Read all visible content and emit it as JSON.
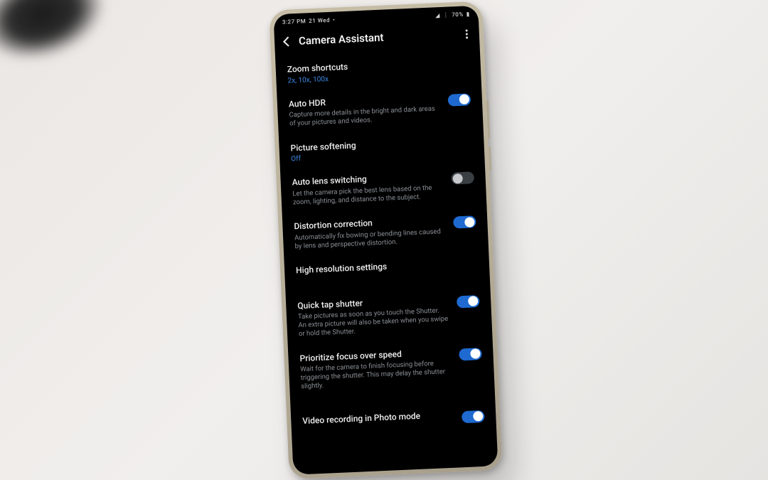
{
  "status": {
    "time": "3:27 PM",
    "date": "21 Wed",
    "battery": "70%"
  },
  "header": {
    "title": "Camera Assistant"
  },
  "settings": {
    "zoom_shortcuts": {
      "title": "Zoom shortcuts",
      "value": "2x, 10x, 100x"
    },
    "auto_hdr": {
      "title": "Auto HDR",
      "sub": "Capture more details in the bright and dark areas of your pictures and videos.",
      "on": true
    },
    "picture_softening": {
      "title": "Picture softening",
      "value": "Off"
    },
    "auto_lens": {
      "title": "Auto lens switching",
      "sub": "Let the camera pick the best lens based on the zoom, lighting, and distance to the subject.",
      "on": false
    },
    "distortion": {
      "title": "Distortion correction",
      "sub": "Automatically fix bowing or bending lines caused by lens and perspective distortion.",
      "on": true
    },
    "high_res": {
      "title": "High resolution settings"
    },
    "quick_tap": {
      "title": "Quick tap shutter",
      "sub": "Take pictures as soon as you touch the Shutter. An extra picture will also be taken when you swipe or hold the Shutter.",
      "on": true
    },
    "prioritize_focus": {
      "title": "Prioritize focus over speed",
      "sub": "Wait for the camera to finish focusing before triggering the shutter. This may delay the shutter slightly.",
      "on": true
    },
    "video_in_photo": {
      "title": "Video recording in Photo mode",
      "on": true
    }
  }
}
